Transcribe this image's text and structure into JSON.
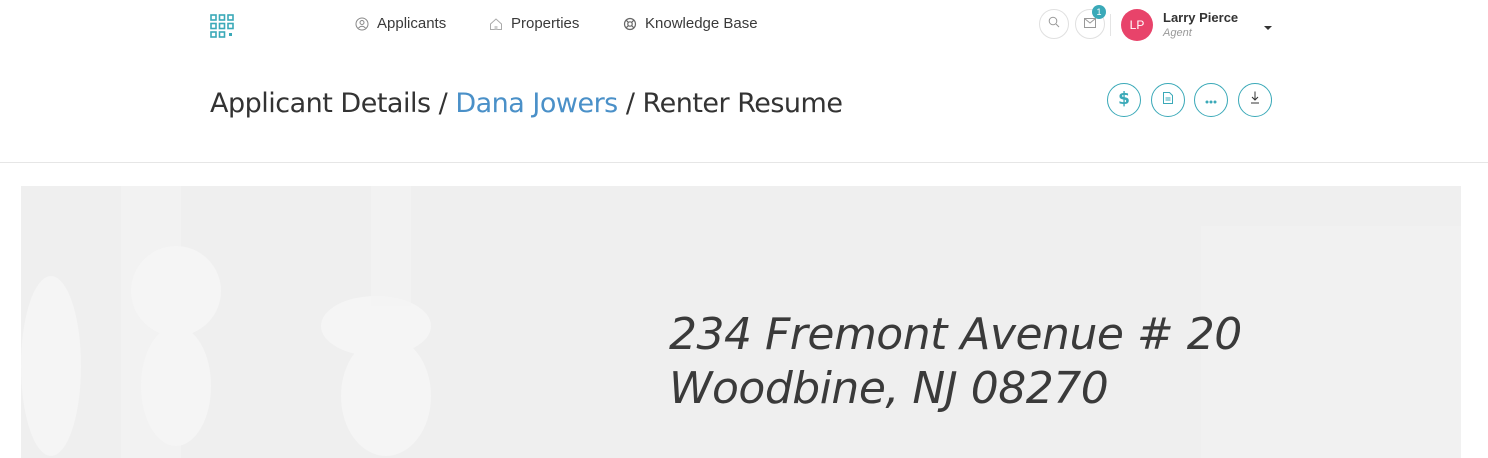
{
  "nav": {
    "items": [
      {
        "label": "Applicants",
        "icon": "user-circle-icon"
      },
      {
        "label": "Properties",
        "icon": "home-icon"
      },
      {
        "label": "Knowledge Base",
        "icon": "lifebuoy-icon"
      }
    ]
  },
  "header_actions": {
    "search_icon": "search-icon",
    "mail_icon": "mail-icon",
    "notification_count": "1"
  },
  "user": {
    "initials": "LP",
    "name": "Larry Pierce",
    "role": "Agent",
    "avatar_color": "#e8436a"
  },
  "breadcrumb": {
    "root": "Applicant Details",
    "separator": "/",
    "applicant": "Dana Jowers",
    "current": "Renter Resume"
  },
  "page_actions": [
    {
      "icon": "dollar-icon"
    },
    {
      "icon": "document-icon"
    },
    {
      "icon": "more-icon"
    },
    {
      "icon": "download-icon"
    }
  ],
  "property": {
    "address_line1": "234 Fremont Avenue # 20",
    "address_line2": "Woodbine, NJ 08270"
  },
  "colors": {
    "accent": "#3aa9b8",
    "link": "#4a90c8"
  }
}
